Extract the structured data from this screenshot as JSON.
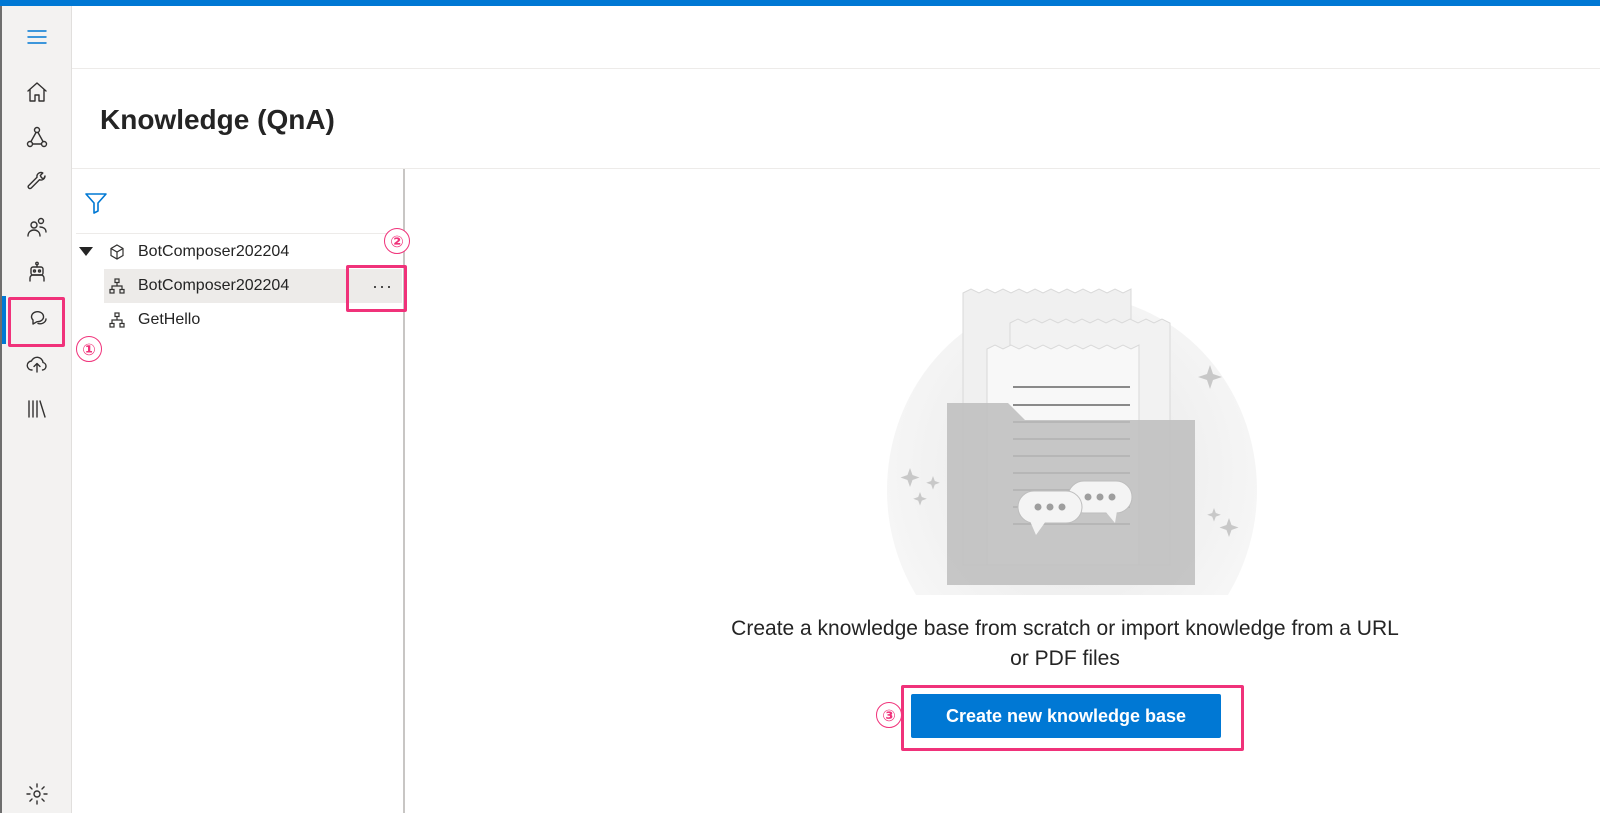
{
  "page": {
    "title": "Knowledge (QnA)"
  },
  "rail": {
    "items": [
      {
        "name": "menu-icon"
      },
      {
        "name": "home-icon"
      },
      {
        "name": "design-icon"
      },
      {
        "name": "configure-icon"
      },
      {
        "name": "users-icon"
      },
      {
        "name": "bot-responses-icon"
      },
      {
        "name": "knowledge-qna-icon"
      },
      {
        "name": "publish-icon"
      },
      {
        "name": "package-manager-icon"
      },
      {
        "name": "settings-icon"
      }
    ]
  },
  "tree": {
    "root": {
      "label": "BotComposer202204"
    },
    "children": [
      {
        "label": "BotComposer202204",
        "selected": true
      },
      {
        "label": "GetHello",
        "selected": false
      }
    ],
    "more_label": "···"
  },
  "empty_state": {
    "message": "Create a knowledge base from scratch or import knowledge from a URL or PDF files",
    "button_label": "Create new knowledge base"
  },
  "annotations": {
    "callout_1": "①",
    "callout_2": "②",
    "callout_3": "③",
    "highlight_color": "#f0327a"
  },
  "colors": {
    "accent": "#0078d4"
  }
}
